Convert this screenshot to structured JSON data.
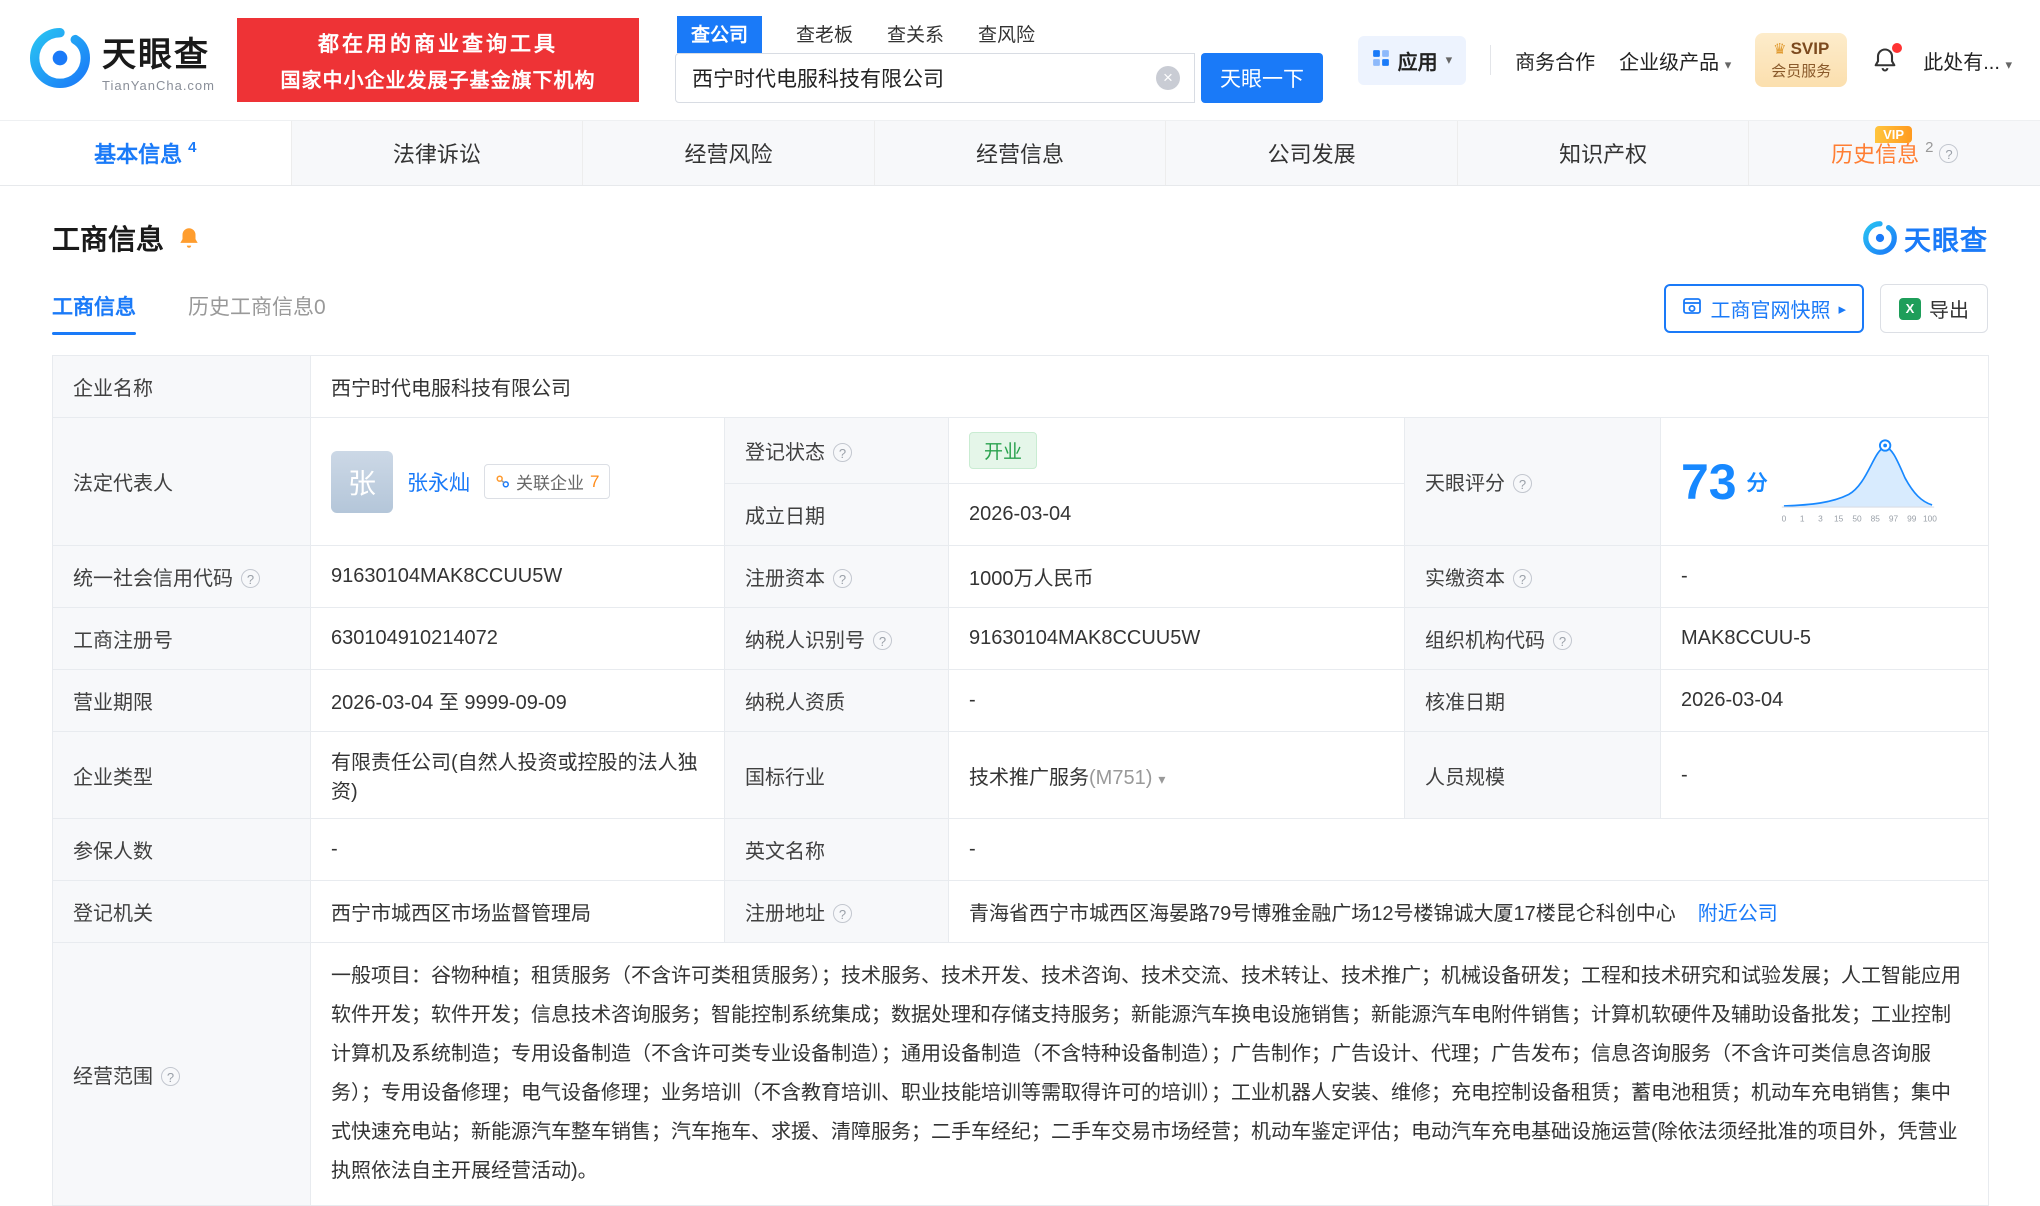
{
  "colors": {
    "accent_blue": "#1a7af8",
    "brand_red": "#ee3336",
    "vip_orange": "#ff9a2e",
    "status_green": "#2aa24e",
    "score_blue": "#1788ff"
  },
  "header": {
    "logo": {
      "brand": "天眼查",
      "domain": "TianYanCha.com"
    },
    "banner": {
      "line1": "都在用的商业查询工具",
      "line2": "国家中小企业发展子基金旗下机构"
    },
    "search": {
      "tabs": [
        {
          "label": "查公司"
        },
        {
          "label": "查老板"
        },
        {
          "label": "查关系"
        },
        {
          "label": "查风险"
        }
      ],
      "value": "西宁时代电服科技有限公司",
      "button": "天眼一下"
    },
    "right": {
      "apps": "应用",
      "biz": "商务合作",
      "enterprise": "企业级产品",
      "svip_line1": "SVIP",
      "svip_line2": "会员服务",
      "more": "此处有..."
    }
  },
  "nav_tabs": [
    {
      "label": "基本信息",
      "count": "4"
    },
    {
      "label": "法律诉讼"
    },
    {
      "label": "经营风险"
    },
    {
      "label": "经营信息"
    },
    {
      "label": "公司发展"
    },
    {
      "label": "知识产权"
    },
    {
      "label": "历史信息",
      "count": "2",
      "vip": "VIP"
    }
  ],
  "section": {
    "title": "工商信息",
    "watermark": "天眼查",
    "sub_tabs": [
      {
        "label": "工商信息"
      },
      {
        "label": "历史工商信息0"
      }
    ],
    "snapshot_btn": "工商官网快照",
    "export_btn": "导出"
  },
  "company": {
    "name_label": "企业名称",
    "name": "西宁时代电服科技有限公司",
    "legal_label": "法定代表人",
    "legal_avatar": "张",
    "legal_name": "张永灿",
    "related_label": "关联企业",
    "related_count": "7",
    "reg_status_label": "登记状态",
    "reg_status": "开业",
    "establish_label": "成立日期",
    "establish_date": "2026-03-04",
    "score_label": "天眼评分",
    "score": "73",
    "score_unit": "分",
    "credit_code_label": "统一社会信用代码",
    "credit_code": "91630104MAK8CCUU5W",
    "reg_capital_label": "注册资本",
    "reg_capital": "1000万人民币",
    "paid_capital_label": "实缴资本",
    "paid_capital": "-",
    "reg_number_label": "工商注册号",
    "reg_number": "630104910214072",
    "taxpayer_id_label": "纳税人识别号",
    "taxpayer_id": "91630104MAK8CCUU5W",
    "org_code_label": "组织机构代码",
    "org_code": "MAK8CCUU-5",
    "term_label": "营业期限",
    "term": "2026-03-04 至 9999-09-09",
    "taxpayer_quality_label": "纳税人资质",
    "taxpayer_quality": "-",
    "approve_date_label": "核准日期",
    "approve_date": "2026-03-04",
    "type_label": "企业类型",
    "type": "有限责任公司(自然人投资或控股的法人独资)",
    "industry_label": "国标行业",
    "industry": "技术推广服务",
    "industry_code": "(M751)",
    "staff_label": "人员规模",
    "staff": "-",
    "insured_label": "参保人数",
    "insured": "-",
    "en_name_label": "英文名称",
    "en_name": "-",
    "authority_label": "登记机关",
    "authority": "西宁市城西区市场监督管理局",
    "address_label": "注册地址",
    "address": "青海省西宁市城西区海晏路79号博雅金融广场12号楼锦诚大厦17楼昆仑科创中心",
    "nearby": "附近公司",
    "scope_label": "经营范围",
    "scope": "一般项目：谷物种植；租赁服务（不含许可类租赁服务）；技术服务、技术开发、技术咨询、技术交流、技术转让、技术推广；机械设备研发；工程和技术研究和试验发展；人工智能应用软件开发；软件开发；信息技术咨询服务；智能控制系统集成；数据处理和存储支持服务；新能源汽车换电设施销售；新能源汽车电附件销售；计算机软硬件及辅助设备批发；工业控制计算机及系统制造；专用设备制造（不含许可类专业设备制造）；通用设备制造（不含特种设备制造）；广告制作；广告设计、代理；广告发布；信息咨询服务（不含许可类信息咨询服务）；专用设备修理；电气设备修理；业务培训（不含教育培训、职业技能培训等需取得许可的培训）；工业机器人安装、维修；充电控制设备租赁；蓄电池租赁；机动车充电销售；集中式快速充电站；新能源汽车整车销售；汽车拖车、求援、清障服务；二手车经纪；二手车交易市场经营；机动车鉴定评估；电动汽车充电基础设施运营(除依法须经批准的项目外，凭营业执照依法自主开展经营活动)。"
  },
  "score_chart": {
    "type": "area",
    "axis_ticks": [
      "0",
      "1",
      "3",
      "15",
      "50",
      "85",
      "97",
      "99",
      "100"
    ],
    "marker_value": "73"
  }
}
